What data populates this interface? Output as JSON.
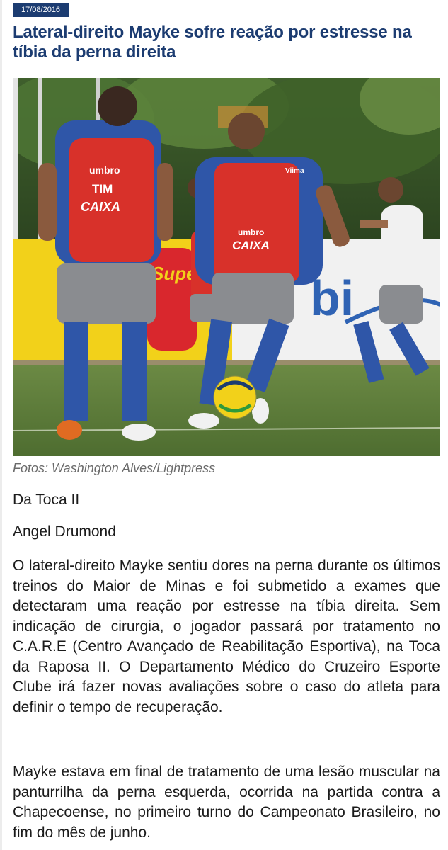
{
  "article": {
    "date": "17/08/2016",
    "headline": "Lateral-direito Mayke sofre reação por estresse na tíbia da perna direita",
    "photo_caption": "Fotos: Washington Alves/Lightpress",
    "location": "Da Toca II",
    "author": "Angel Drumond",
    "paragraphs": [
      "O lateral-direito Mayke sentiu dores na perna durante os últimos treinos do Maior de Minas e foi submetido a exames que detectaram uma reação por estresse na tíbia direita. Sem indicação de cirurgia, o jogador passará por tratamento no C.A.R.E (Centro Avançado de Reabilitação Esportiva), na Toca da Raposa II. O Departamento Médico do Cruzeiro Esporte Clube irá fazer novas avaliações sobre o caso do atleta para definir o tempo de recuperação.",
      "Mayke estava em final de tratamento de uma lesão muscular na panturrilha da perna esquerda, ocorrida na partida contra a Chapecoense, no primeiro turno do Campeonato Brasileiro, no fim do mês de junho."
    ]
  },
  "photo": {
    "bib_text_1": "umbro",
    "bib_text_2": "TIM",
    "bib_text_3": "CAIXA",
    "bib_text_4": "Viima",
    "banner_text_1": "Super",
    "banner_text_2": "bi",
    "colors": {
      "bib_red": "#d8312a",
      "shirt_blue": "#2f56a8",
      "shorts_grey": "#8a8c90",
      "grass": "#5a7d3a",
      "banner_yellow": "#f2d11a",
      "banner_white": "#f1f1f1",
      "brand_navy": "#1c3c71"
    }
  }
}
